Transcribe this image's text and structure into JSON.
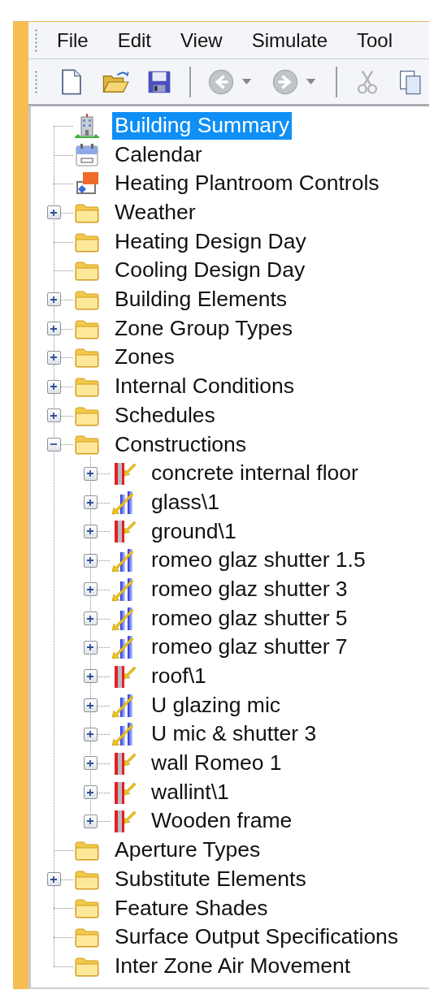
{
  "menu": [
    "File",
    "Edit",
    "View",
    "Simulate",
    "Tool"
  ],
  "toolbar": [
    {
      "kind": "new",
      "disabled": false
    },
    {
      "kind": "open",
      "disabled": false
    },
    {
      "kind": "save",
      "disabled": false
    },
    {
      "kind": "separator"
    },
    {
      "kind": "back",
      "disabled": true
    },
    {
      "kind": "forward",
      "disabled": true
    },
    {
      "kind": "separator"
    },
    {
      "kind": "cut",
      "disabled": true
    },
    {
      "kind": "copy",
      "disabled": false
    }
  ],
  "tree": [
    {
      "label": "Building Summary",
      "kind": "building",
      "expandable": false,
      "selected": true
    },
    {
      "label": "Calendar",
      "kind": "calendar",
      "expandable": false,
      "selected": false
    },
    {
      "label": "Heating Plantroom Controls",
      "kind": "plantroom",
      "expandable": false,
      "selected": false
    },
    {
      "label": "Weather",
      "kind": "folder",
      "expandable": true,
      "expanded": false,
      "selected": false
    },
    {
      "label": "Heating Design Day",
      "kind": "folder",
      "expandable": false,
      "selected": false
    },
    {
      "label": "Cooling Design Day",
      "kind": "folder",
      "expandable": false,
      "selected": false
    },
    {
      "label": "Building Elements",
      "kind": "folder",
      "expandable": true,
      "expanded": false,
      "selected": false
    },
    {
      "label": "Zone Group Types",
      "kind": "folder",
      "expandable": true,
      "expanded": false,
      "selected": false
    },
    {
      "label": "Zones",
      "kind": "folder",
      "expandable": true,
      "expanded": false,
      "selected": false
    },
    {
      "label": "Internal Conditions",
      "kind": "folder",
      "expandable": true,
      "expanded": false,
      "selected": false
    },
    {
      "label": "Schedules",
      "kind": "folder",
      "expandable": true,
      "expanded": false,
      "selected": false
    },
    {
      "label": "Constructions",
      "kind": "folder",
      "expandable": true,
      "expanded": true,
      "selected": false,
      "children": [
        {
          "label": "concrete internal floor",
          "kind": "opaque",
          "expandable": true,
          "expanded": false,
          "selected": false
        },
        {
          "label": "glass\\1",
          "kind": "glazed",
          "expandable": true,
          "expanded": false,
          "selected": false
        },
        {
          "label": "ground\\1",
          "kind": "opaque",
          "expandable": true,
          "expanded": false,
          "selected": false
        },
        {
          "label": "romeo glaz shutter 1.5",
          "kind": "glazed",
          "expandable": true,
          "expanded": false,
          "selected": false
        },
        {
          "label": "romeo glaz shutter 3",
          "kind": "glazed",
          "expandable": true,
          "expanded": false,
          "selected": false
        },
        {
          "label": "romeo glaz shutter 5",
          "kind": "glazed",
          "expandable": true,
          "expanded": false,
          "selected": false
        },
        {
          "label": "romeo glaz shutter 7",
          "kind": "glazed",
          "expandable": true,
          "expanded": false,
          "selected": false
        },
        {
          "label": "roof\\1",
          "kind": "opaque",
          "expandable": true,
          "expanded": false,
          "selected": false
        },
        {
          "label": "U glazing mic",
          "kind": "glazed",
          "expandable": true,
          "expanded": false,
          "selected": false
        },
        {
          "label": "U mic & shutter 3",
          "kind": "glazed",
          "expandable": true,
          "expanded": false,
          "selected": false
        },
        {
          "label": "wall Romeo 1",
          "kind": "opaque",
          "expandable": true,
          "expanded": false,
          "selected": false
        },
        {
          "label": "wallint\\1",
          "kind": "opaque",
          "expandable": true,
          "expanded": false,
          "selected": false
        },
        {
          "label": "Wooden frame",
          "kind": "opaque",
          "expandable": true,
          "expanded": false,
          "selected": false
        }
      ]
    },
    {
      "label": "Aperture Types",
      "kind": "folder",
      "expandable": false,
      "selected": false
    },
    {
      "label": "Substitute Elements",
      "kind": "folder",
      "expandable": true,
      "expanded": false,
      "selected": false
    },
    {
      "label": "Feature Shades",
      "kind": "folder",
      "expandable": false,
      "selected": false
    },
    {
      "label": "Surface Output Specifications",
      "kind": "folder",
      "expandable": false,
      "selected": false
    },
    {
      "label": "Inter Zone Air Movement",
      "kind": "folder",
      "expandable": false,
      "selected": false
    }
  ]
}
